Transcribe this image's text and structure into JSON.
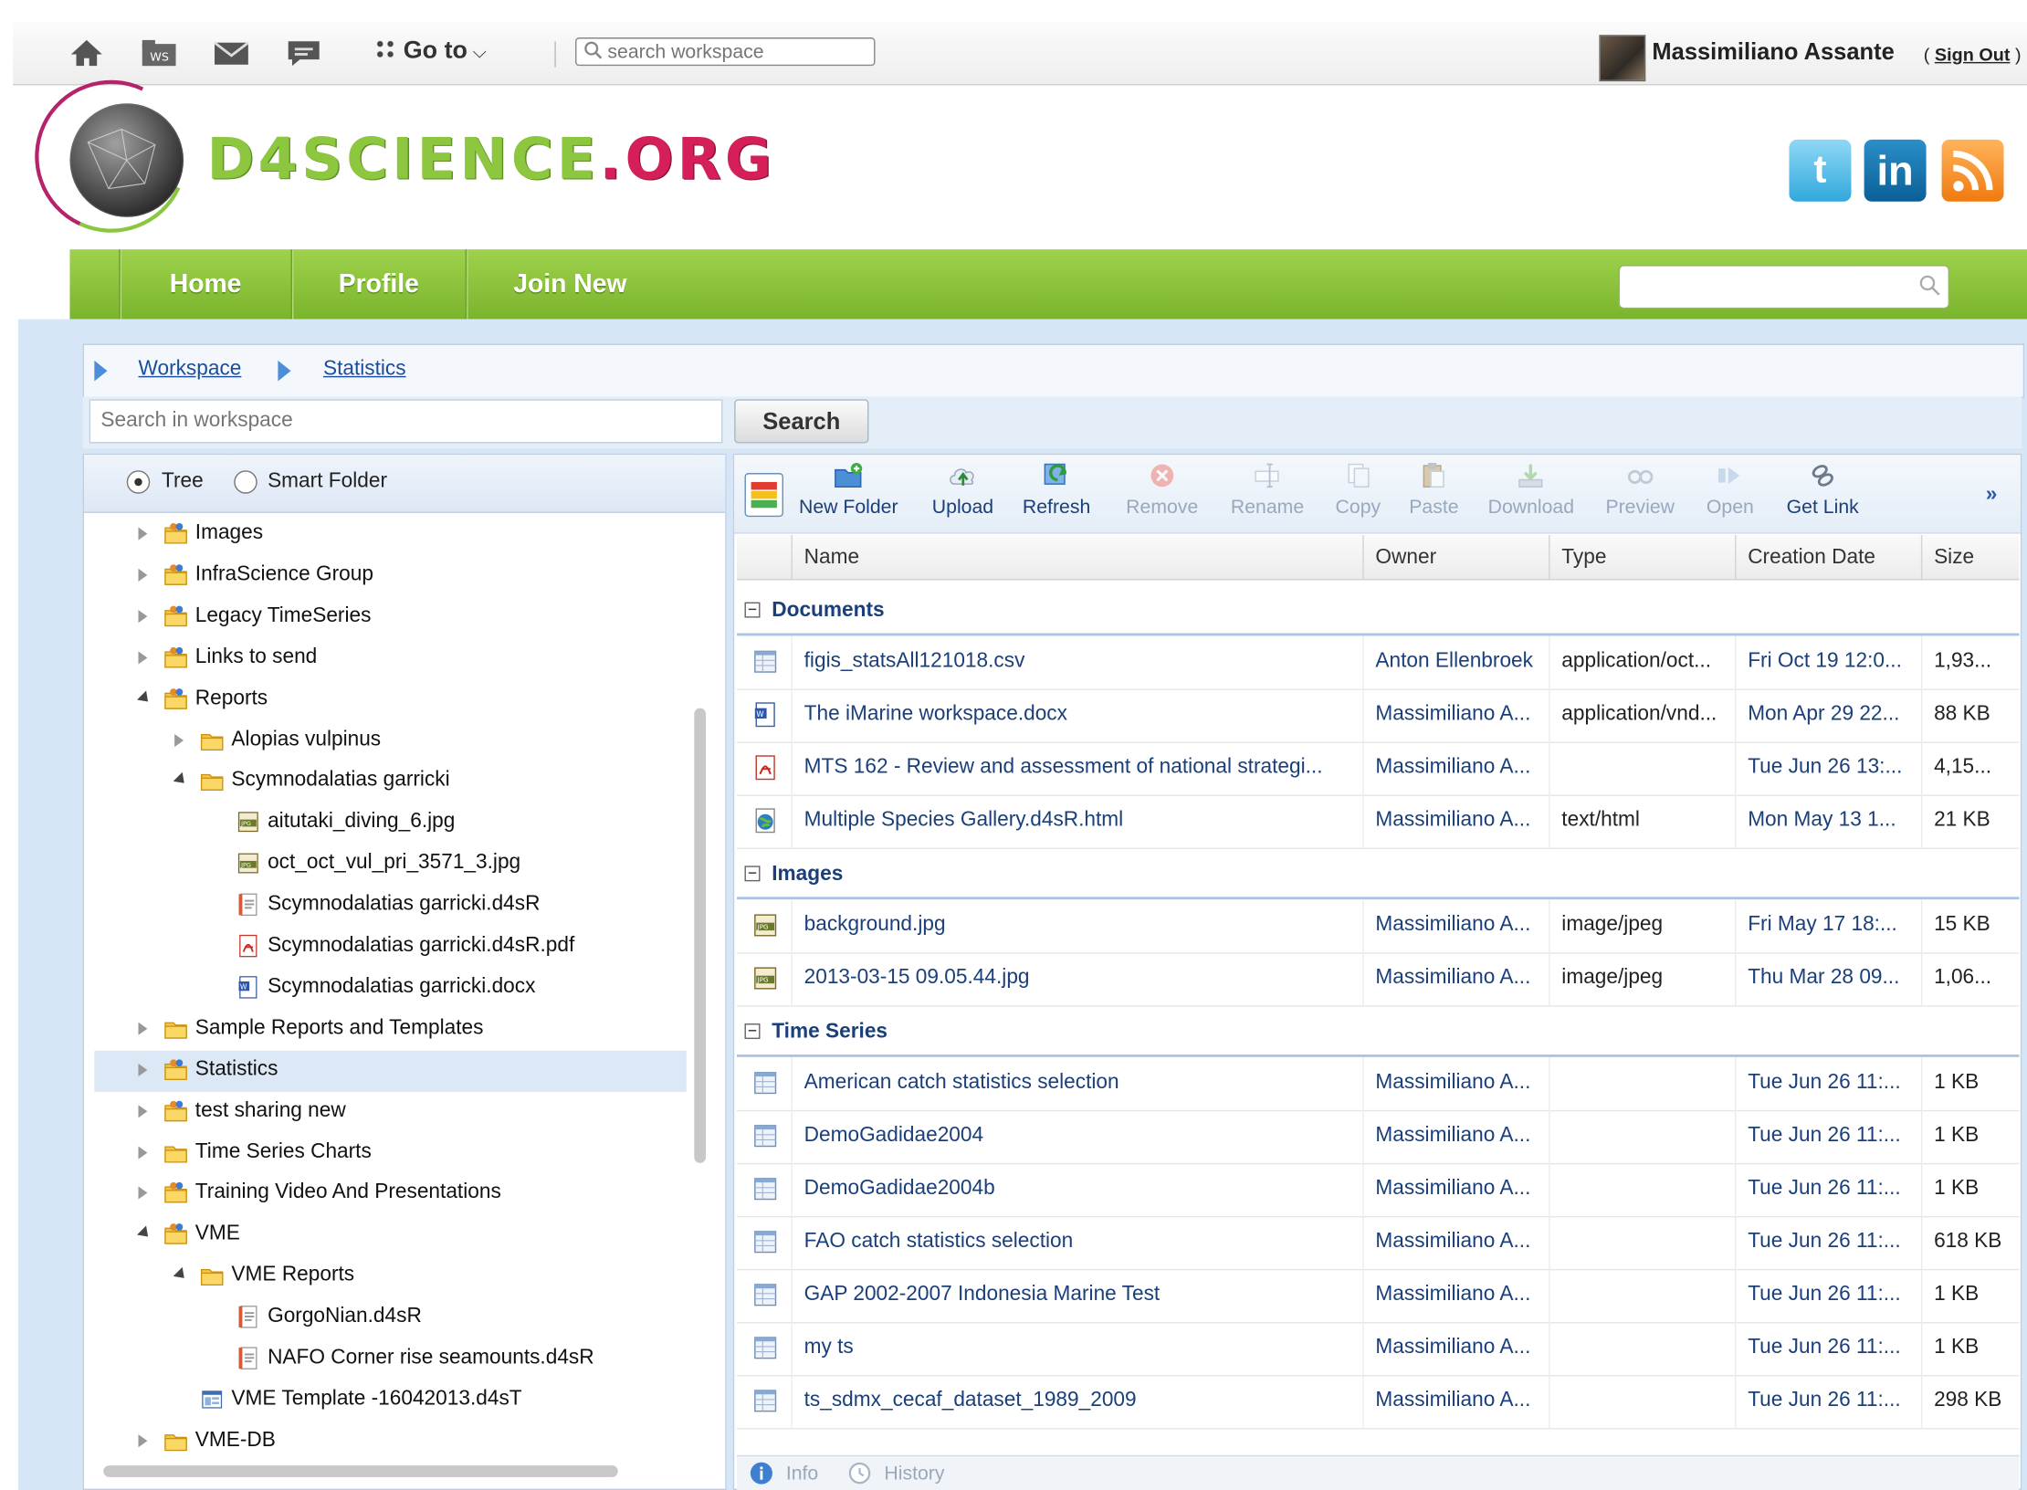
{
  "topbar": {
    "goto_label": "Go to",
    "search_placeholder": "search workspace",
    "user_name": "Massimiliano Assante",
    "sign_out": "Sign Out"
  },
  "header": {
    "logo_text_part1": "D4SCIENCE",
    "logo_text_part2": ".ORG"
  },
  "nav": {
    "items": [
      "Home",
      "Profile",
      "Join New"
    ]
  },
  "breadcrumb": [
    "Workspace",
    "Statistics"
  ],
  "workspace_search": {
    "placeholder": "Search in workspace",
    "button": "Search"
  },
  "tree_modes": [
    "Tree",
    "Smart Folder"
  ],
  "tree": [
    {
      "label": "Images",
      "depth": 0,
      "toggle": "collapsed",
      "icon": "shared-folder-icon"
    },
    {
      "label": "InfraScience Group",
      "depth": 0,
      "toggle": "collapsed",
      "icon": "shared-folder-icon"
    },
    {
      "label": "Legacy TimeSeries",
      "depth": 0,
      "toggle": "collapsed",
      "icon": "shared-folder-icon"
    },
    {
      "label": "Links to send",
      "depth": 0,
      "toggle": "collapsed",
      "icon": "shared-folder-icon"
    },
    {
      "label": "Reports",
      "depth": 0,
      "toggle": "expanded",
      "icon": "shared-folder-icon"
    },
    {
      "label": "Alopias vulpinus",
      "depth": 1,
      "toggle": "collapsed",
      "icon": "folder-icon"
    },
    {
      "label": "Scymnodalatias garricki",
      "depth": 1,
      "toggle": "expanded",
      "icon": "folder-icon"
    },
    {
      "label": "aitutaki_diving_6.jpg",
      "depth": 2,
      "toggle": "none",
      "icon": "jpg-file-icon"
    },
    {
      "label": "oct_oct_vul_pri_3571_3.jpg",
      "depth": 2,
      "toggle": "none",
      "icon": "jpg-file-icon"
    },
    {
      "label": "Scymnodalatias garricki.d4sR",
      "depth": 2,
      "toggle": "none",
      "icon": "report-file-icon"
    },
    {
      "label": "Scymnodalatias garricki.d4sR.pdf",
      "depth": 2,
      "toggle": "none",
      "icon": "pdf-file-icon"
    },
    {
      "label": "Scymnodalatias garricki.docx",
      "depth": 2,
      "toggle": "none",
      "icon": "word-file-icon"
    },
    {
      "label": "Sample Reports and Templates",
      "depth": 0,
      "toggle": "collapsed",
      "icon": "folder-icon"
    },
    {
      "label": "Statistics",
      "depth": 0,
      "toggle": "collapsed",
      "icon": "shared-folder-icon",
      "selected": true
    },
    {
      "label": "test sharing new",
      "depth": 0,
      "toggle": "collapsed",
      "icon": "shared-folder-icon"
    },
    {
      "label": "Time Series Charts",
      "depth": 0,
      "toggle": "collapsed",
      "icon": "folder-icon"
    },
    {
      "label": "Training Video And Presentations",
      "depth": 0,
      "toggle": "collapsed",
      "icon": "shared-folder-icon"
    },
    {
      "label": "VME",
      "depth": 0,
      "toggle": "expanded",
      "icon": "shared-folder-icon"
    },
    {
      "label": "VME Reports",
      "depth": 1,
      "toggle": "expanded",
      "icon": "folder-icon"
    },
    {
      "label": "GorgoNian.d4sR",
      "depth": 2,
      "toggle": "none",
      "icon": "report-file-icon"
    },
    {
      "label": "NAFO Corner rise seamounts.d4sR",
      "depth": 2,
      "toggle": "none",
      "icon": "report-file-icon"
    },
    {
      "label": "VME Template -16042013.d4sT",
      "depth": 1,
      "toggle": "none",
      "icon": "template-file-icon"
    },
    {
      "label": "VME-DB",
      "depth": 0,
      "toggle": "collapsed",
      "icon": "folder-icon"
    }
  ],
  "toolbar": [
    {
      "label": "New Folder",
      "enabled": true,
      "icon": "new-folder-icon"
    },
    {
      "label": "Upload",
      "enabled": true,
      "icon": "upload-icon"
    },
    {
      "label": "Refresh",
      "enabled": true,
      "icon": "refresh-icon"
    },
    {
      "label": "Remove",
      "enabled": false,
      "icon": "remove-icon"
    },
    {
      "label": "Rename",
      "enabled": false,
      "icon": "rename-icon"
    },
    {
      "label": "Copy",
      "enabled": false,
      "icon": "copy-icon"
    },
    {
      "label": "Paste",
      "enabled": false,
      "icon": "paste-icon"
    },
    {
      "label": "Download",
      "enabled": false,
      "icon": "download-icon"
    },
    {
      "label": "Preview",
      "enabled": false,
      "icon": "preview-icon"
    },
    {
      "label": "Open",
      "enabled": false,
      "icon": "open-icon"
    },
    {
      "label": "Get Link",
      "enabled": true,
      "icon": "get-link-icon"
    }
  ],
  "more_label": "»",
  "columns": [
    "Name",
    "Owner",
    "Type",
    "Creation Date",
    "Size"
  ],
  "groups": [
    {
      "label": "Documents",
      "rows": [
        {
          "name": "figis_statsAll121018.csv",
          "owner": "Anton Ellenbroek",
          "type": "application/oct...",
          "date": "Fri Oct 19 12:0...",
          "size": "1,93...",
          "icon": "csv-file-icon"
        },
        {
          "name": "The iMarine workspace.docx",
          "owner": "Massimiliano A...",
          "type": "application/vnd...",
          "date": "Mon Apr 29 22...",
          "size": "88 KB",
          "icon": "word-file-icon"
        },
        {
          "name": "MTS 162 - Review and assessment of national strategi...",
          "owner": "Massimiliano A...",
          "type": "",
          "date": "Tue Jun 26 13:...",
          "size": "4,15...",
          "icon": "pdf-file-icon"
        },
        {
          "name": "Multiple Species Gallery.d4sR.html",
          "owner": "Massimiliano A...",
          "type": "text/html",
          "date": "Mon May 13 1...",
          "size": "21 KB",
          "icon": "html-file-icon"
        }
      ]
    },
    {
      "label": "Images",
      "rows": [
        {
          "name": "background.jpg",
          "owner": "Massimiliano A...",
          "type": "image/jpeg",
          "date": "Fri May 17 18:...",
          "size": "15 KB",
          "icon": "jpg-file-icon"
        },
        {
          "name": "2013-03-15 09.05.44.jpg",
          "owner": "Massimiliano A...",
          "type": "image/jpeg",
          "date": "Thu Mar 28 09...",
          "size": "1,06...",
          "icon": "jpg-file-icon"
        }
      ]
    },
    {
      "label": "Time Series",
      "rows": [
        {
          "name": "American catch statistics selection",
          "owner": "Massimiliano A...",
          "type": "",
          "date": "Tue Jun 26 11:...",
          "size": "1 KB",
          "icon": "timeseries-file-icon"
        },
        {
          "name": "DemoGadidae2004",
          "owner": "Massimiliano A...",
          "type": "",
          "date": "Tue Jun 26 11:...",
          "size": "1 KB",
          "icon": "timeseries-file-icon"
        },
        {
          "name": "DemoGadidae2004b",
          "owner": "Massimiliano A...",
          "type": "",
          "date": "Tue Jun 26 11:...",
          "size": "1 KB",
          "icon": "timeseries-file-icon"
        },
        {
          "name": "FAO catch statistics selection",
          "owner": "Massimiliano A...",
          "type": "",
          "date": "Tue Jun 26 11:...",
          "size": "618 KB",
          "icon": "timeseries-file-icon"
        },
        {
          "name": "GAP 2002-2007 Indonesia Marine Test",
          "owner": "Massimiliano A...",
          "type": "",
          "date": "Tue Jun 26 11:...",
          "size": "1 KB",
          "icon": "timeseries-file-icon"
        },
        {
          "name": "my ts",
          "owner": "Massimiliano A...",
          "type": "",
          "date": "Tue Jun 26 11:...",
          "size": "1 KB",
          "icon": "timeseries-file-icon"
        },
        {
          "name": "ts_sdmx_cecaf_dataset_1989_2009",
          "owner": "Massimiliano A...",
          "type": "",
          "date": "Tue Jun 26 11:...",
          "size": "298 KB",
          "icon": "timeseries-file-icon"
        }
      ]
    }
  ],
  "statusbar": {
    "info": "Info",
    "history": "History"
  },
  "colors": {
    "nav_green": "#8cc63f",
    "brand_magenta": "#d41f58",
    "link_blue": "#1a4d9c",
    "panel_blue": "#d6e6f7"
  }
}
